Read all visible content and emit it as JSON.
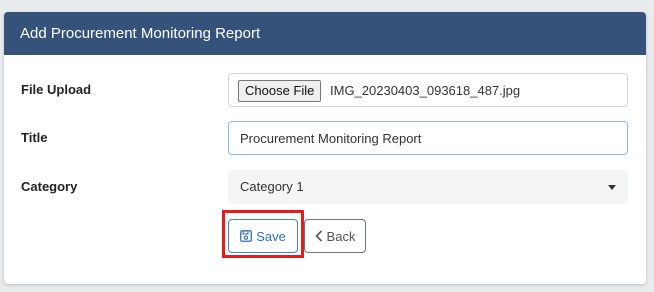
{
  "header": {
    "title": "Add Procurement Monitoring Report"
  },
  "form": {
    "file_upload": {
      "label": "File Upload",
      "button_label": "Choose File",
      "file_name": "IMG_20230403_093618_487.jpg"
    },
    "title": {
      "label": "Title",
      "value": "Procurement Monitoring Report"
    },
    "category": {
      "label": "Category",
      "selected": "Category 1"
    }
  },
  "actions": {
    "save_label": "Save",
    "back_label": "Back"
  },
  "icons": {
    "save": "floppy-disk-icon",
    "back": "chevron-left-icon",
    "dropdown": "caret-down-icon"
  },
  "colors": {
    "header_bg": "#34527a",
    "primary": "#3a86d9",
    "highlight": "#e41e1e"
  }
}
